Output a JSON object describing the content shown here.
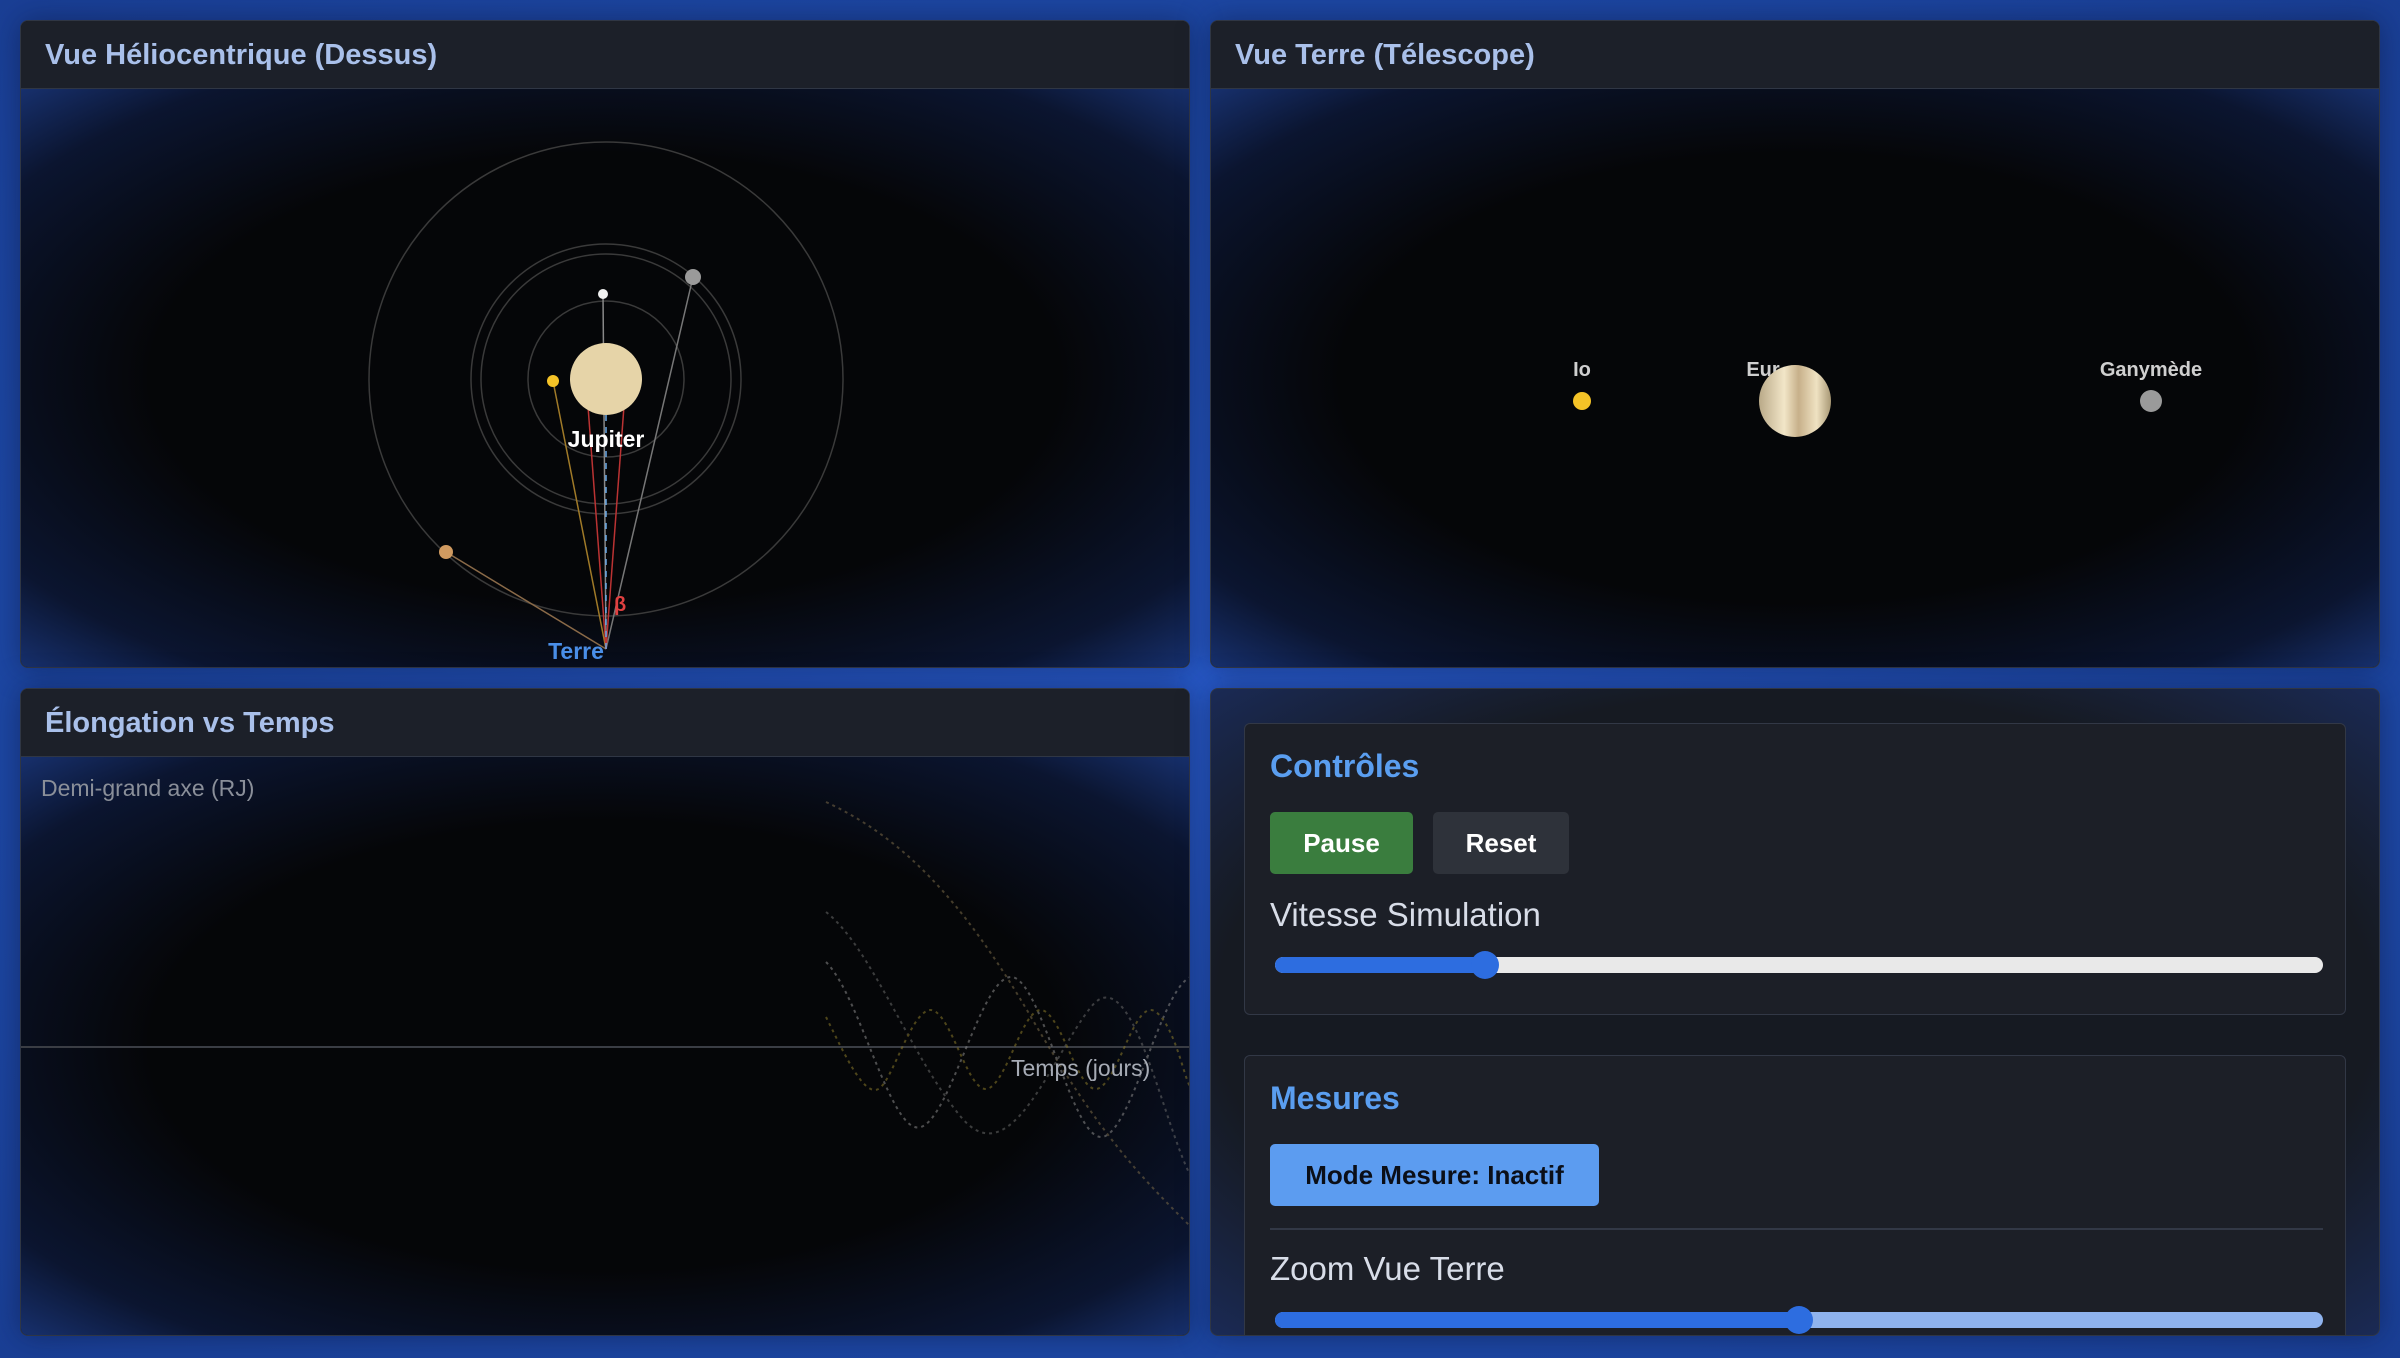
{
  "panels": {
    "helio": {
      "title": "Vue Héliocentrique (Dessus)",
      "jupiter_label": "Jupiter",
      "earth_label": "Terre",
      "angle_label": "β"
    },
    "telescope": {
      "title": "Vue Terre (Télescope)",
      "moons": [
        {
          "label": "Io",
          "color": "#f5c327"
        },
        {
          "label": "Eur",
          "color": "#d8d8d8"
        },
        {
          "label": "Ganymède",
          "color": "#9a9a9a"
        }
      ]
    },
    "chart": {
      "title": "Élongation vs Temps",
      "ylabel": "Demi-grand axe (RJ)",
      "xlabel": "Temps (jours)"
    },
    "controls": {
      "title": "Contrôles",
      "pause_label": "Pause",
      "reset_label": "Reset",
      "speed_label": "Vitesse Simulation",
      "speed_value": 0.2
    },
    "measures": {
      "title": "Mesures",
      "mode_label": "Mode Mesure: Inactif",
      "zoom_label": "Zoom Vue Terre",
      "zoom_value": 0.5
    }
  },
  "colors": {
    "accent": "#5a9ef0",
    "pause": "#3a7d3e",
    "measure_btn": "#5c9cf0",
    "jupiter": "#e6d4a8",
    "earth_label": "#4a8fe8",
    "angle": "#e04040"
  }
}
